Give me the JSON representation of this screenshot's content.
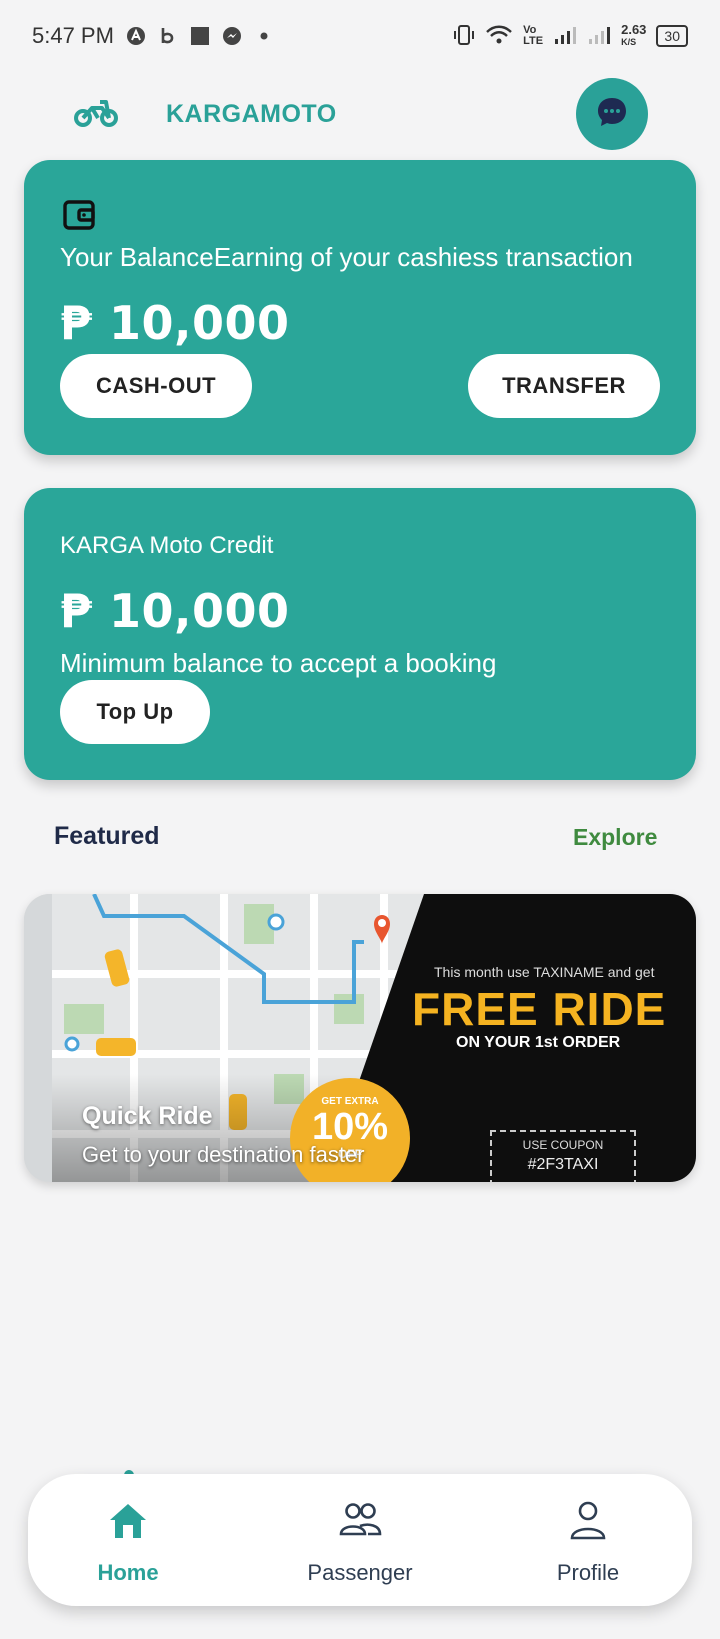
{
  "status_bar": {
    "time": "5:47 PM",
    "net_speed": "2.63",
    "net_unit": "K/S",
    "battery": "30",
    "volte_top": "Vo",
    "volte_bottom": "LTE"
  },
  "header": {
    "brand": "KARGAMOTO"
  },
  "balance_card": {
    "title": "Your BalanceEarning of your cashiess transaction",
    "amount": "₱ 10,000",
    "cashout_label": "CASH-OUT",
    "transfer_label": "TRANSFER"
  },
  "credit_card": {
    "title": "KARGA Moto Credit",
    "amount": "₱ 10,000",
    "subtitle": "Minimum balance to accept a booking",
    "topup_label": "Top Up"
  },
  "featured": {
    "heading": "Featured",
    "explore_label": "Explore",
    "banner": {
      "title": "Quick Ride",
      "subtitle": "Get to your destination faster",
      "promo_month": "This month use TAXINAME and get",
      "promo_headline": "FREE RIDE",
      "promo_order": "ON YOUR 1st ORDER",
      "coupon_label": "USE COUPON",
      "coupon_code": "#2F3TAXI",
      "badge_top": "GET EXTRA",
      "badge_value": "10%",
      "badge_off": "OFF"
    }
  },
  "bottom_nav": {
    "items": [
      {
        "label": "Home",
        "active": true
      },
      {
        "label": "Passenger",
        "active": false
      },
      {
        "label": "Profile",
        "active": false
      }
    ]
  },
  "colors": {
    "accent": "#2aa198",
    "card": "#2aa699",
    "explore": "#3f8a3f",
    "promo": "#f5b321"
  }
}
